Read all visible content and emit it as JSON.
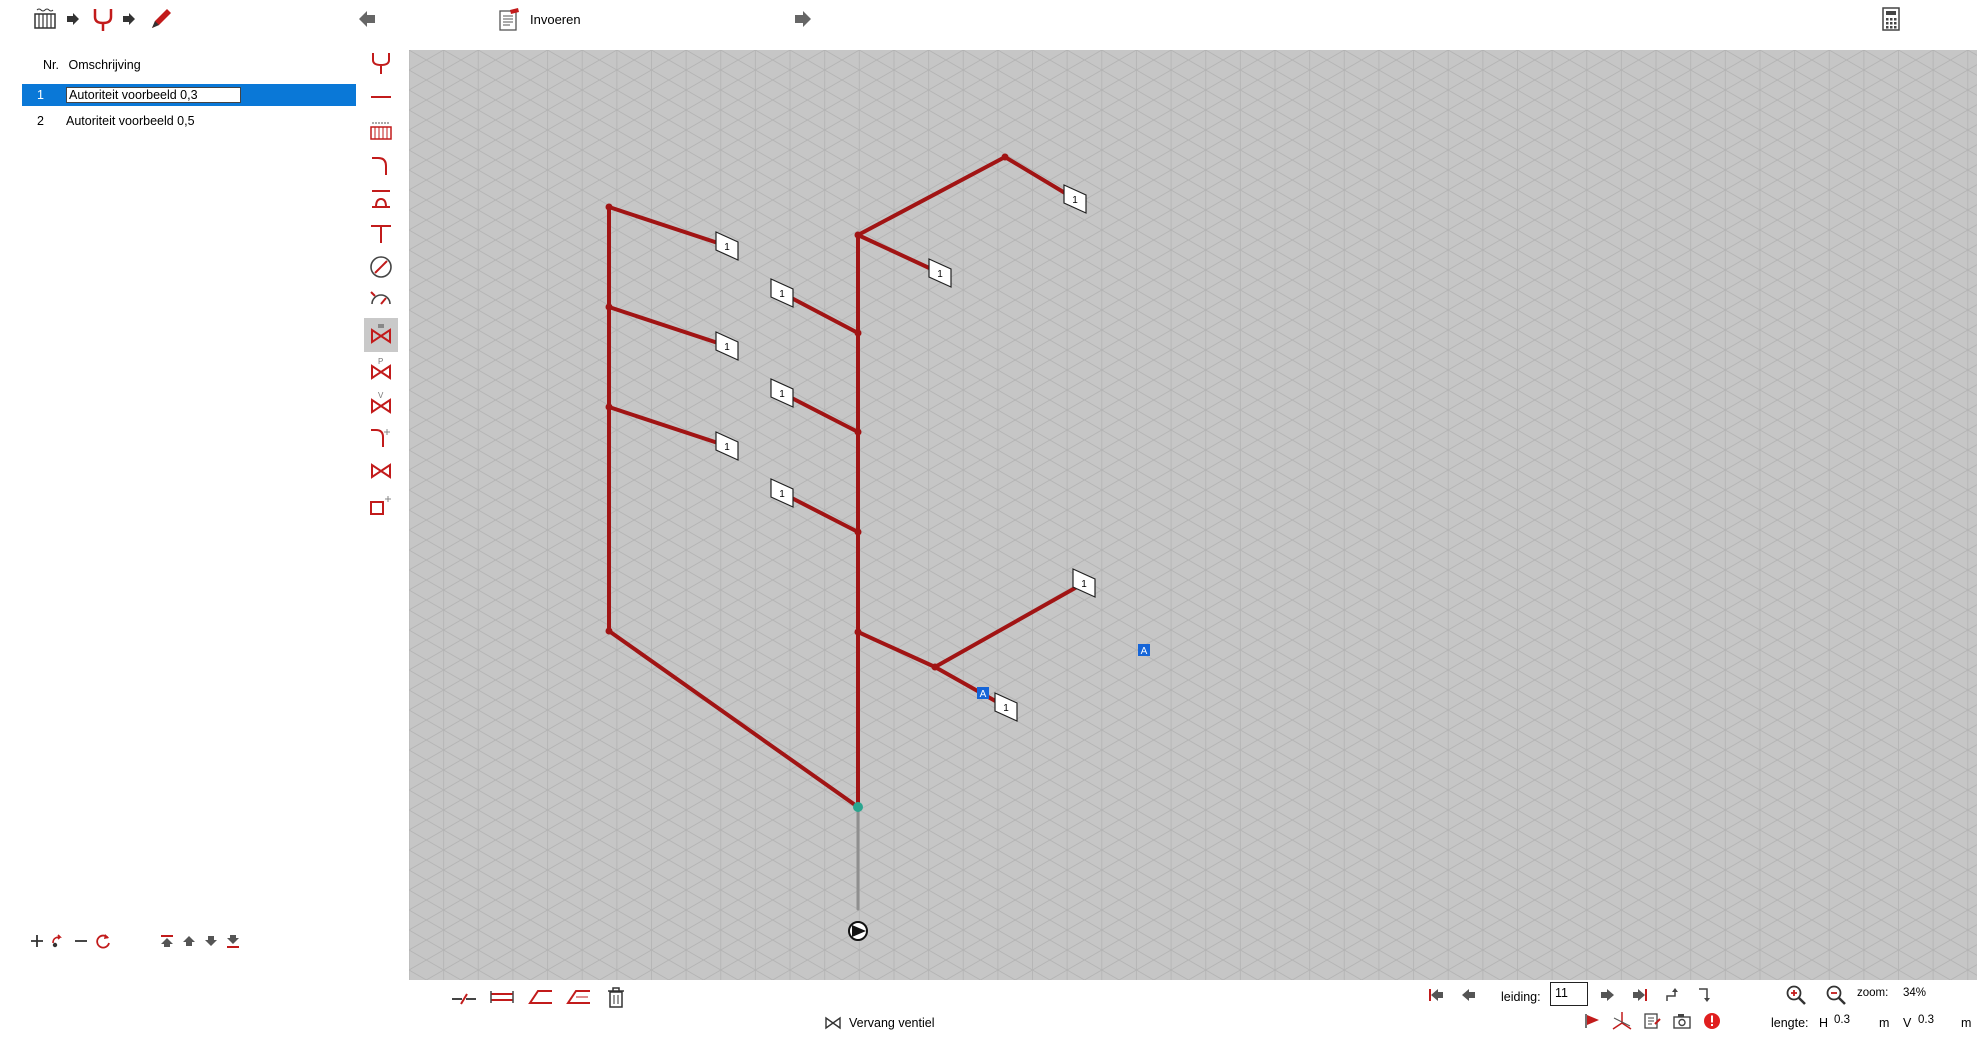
{
  "toolbar": {
    "title_label": "Invoeren",
    "icons": [
      "radiator-icon",
      "arrow-right-icon",
      "pipe-fitting-icon",
      "arrow-right-icon",
      "pencil-icon",
      "arrow-left-icon",
      "document-icon",
      "arrow-right-icon",
      "calculator-icon"
    ]
  },
  "list": {
    "col_nr": "Nr.",
    "col_desc": "Omschrijving",
    "rows": [
      {
        "nr": "1",
        "desc": "Autoriteit voorbeeld 0,3"
      },
      {
        "nr": "2",
        "desc": "Autoriteit voorbeeld 0,5"
      }
    ]
  },
  "canvas": {
    "tag_label": "1",
    "marker_label": "A",
    "pipe_color": "#a11414",
    "grid_bg": "#c6c6c6"
  },
  "footer": {
    "vervang_label": "Vervang ventiel",
    "leiding_label": "leiding:",
    "leiding_value": "11",
    "zoom_label": "zoom:",
    "zoom_value": "34%",
    "lengte_label": "lengte:",
    "h_label": "H",
    "h_value": "0.3",
    "unit_m": "m",
    "v_label": "V",
    "v_value": "0.3"
  }
}
